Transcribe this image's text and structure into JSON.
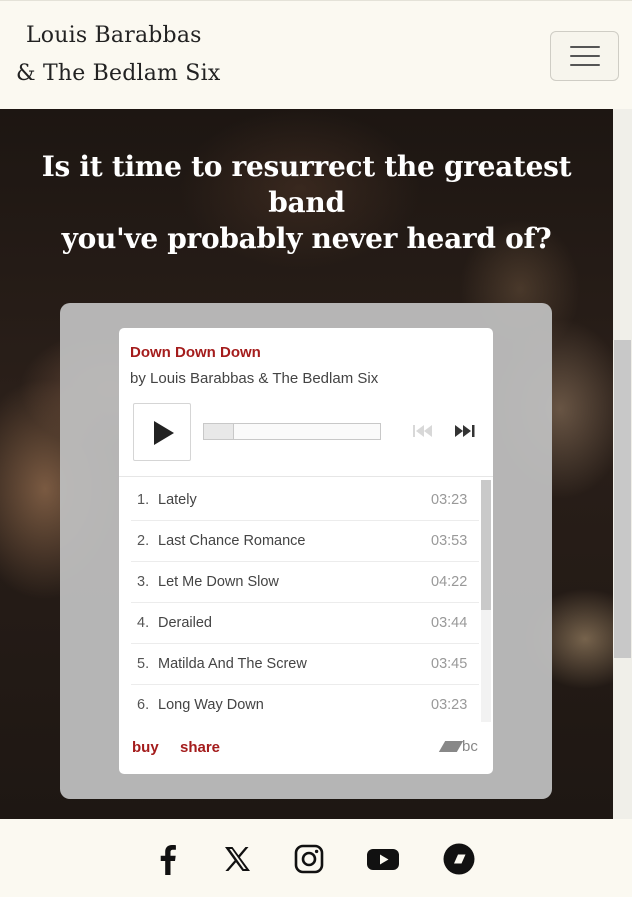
{
  "header": {
    "brand_line1": "Louis Barabbas",
    "brand_line2": "& The Bedlam Six",
    "menu_icon": "hamburger-icon"
  },
  "hero": {
    "title_line1": "Is it time to resurrect the greatest band",
    "title_line2": "you've probably never heard of?"
  },
  "player": {
    "album_title": "Down Down Down",
    "artist": "by Louis Barabbas & The Bedlam Six",
    "accent_color": "#a41c1c",
    "tracks": [
      {
        "num": "1.",
        "name": "Lately",
        "duration": "03:23"
      },
      {
        "num": "2.",
        "name": "Last Chance Romance",
        "duration": "03:53"
      },
      {
        "num": "3.",
        "name": "Let Me Down Slow",
        "duration": "04:22"
      },
      {
        "num": "4.",
        "name": "Derailed",
        "duration": "03:44"
      },
      {
        "num": "5.",
        "name": "Matilda And The Screw",
        "duration": "03:45"
      },
      {
        "num": "6.",
        "name": "Long Way Down",
        "duration": "03:23"
      }
    ],
    "buy_label": "buy",
    "share_label": "share",
    "logo_text": "bc"
  },
  "footer": {
    "icons": [
      "facebook-icon",
      "x-icon",
      "instagram-icon",
      "youtube-icon",
      "bandcamp-icon"
    ]
  }
}
